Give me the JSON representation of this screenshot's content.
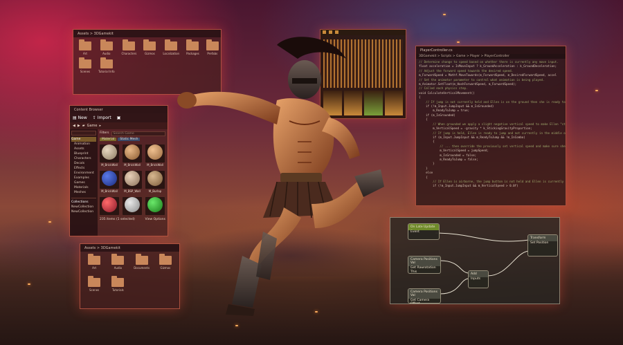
{
  "assets_top": {
    "breadcrumb": "Assets  >  3DGamekit",
    "folders": [
      "Art",
      "Audio",
      "Characters",
      "Gizmos",
      "Localization",
      "Packages",
      "Prefabs",
      "Scenes",
      "Tutorial Info"
    ]
  },
  "content_browser": {
    "title": "Content Browser",
    "new_label": "New",
    "import_label": "Import",
    "path_label": "Game",
    "filters_label": "Filters",
    "search_placeholder": "Search Game",
    "tree": [
      "Game",
      "Animation",
      "Assets",
      "Blueprint",
      "Characters",
      "Decals",
      "Effects",
      "Environment",
      "Examples",
      "Games",
      "Materials",
      "Meshes"
    ],
    "collections_label": "Collections",
    "collection_items": [
      "NewCollection",
      "NewCollection"
    ],
    "type_tabs": [
      "Material",
      "Static Mesh"
    ],
    "assets": [
      "M_BrickWall",
      "M_BrickWall",
      "M_BrickWall",
      "M_BrickWall",
      "M_BSP_Wall",
      "M_Burlap",
      "",
      "",
      ""
    ],
    "status": "235 items (1 selected)",
    "view_options": "View Options"
  },
  "assets_bottom": {
    "breadcrumb": "Assets  >  3DGamekit",
    "folders": [
      "Art",
      "Audio",
      "Documents",
      "Gizmos",
      "Scenes",
      "Tutorials"
    ]
  },
  "code_editor": {
    "tab": "PlayerController.cs",
    "path": "3DGamekit  >  Scripts  >  Game  >  Player  >  PlayerController",
    "lines": [
      "// Determine change to speed based on whether there is currently any move input.",
      "float acceleration = IsMoveInput ? k_GroundAcceleration : k_GroundDeceleration;",
      "",
      "// Adjust the forward speed towards the desired speed.",
      "m_ForwardSpeed = Mathf.MoveTowards(m_ForwardSpeed, m_DesiredForwardSpeed, accel",
      "",
      "// Set the animator parameter to control what animation is being played.",
      "m_Animator.SetFloat(m_HashForwardSpeed, m_ForwardSpeed);",
      "",
      "",
      "// Called each physics step.",
      "void CalculateVerticalMovement()",
      "{",
      "    // If jump is not currently held and Ellen is on the ground then she is ready to",
      "    if (!m_Input.JumpInput && m_IsGrounded)",
      "        m_ReadyToJump = true;",
      "",
      "    if (m_IsGrounded)",
      "    {",
      "        // When grounded we apply a slight negative vertical speed to make Ellen \"stick\"",
      "        m_VerticalSpeed = -gravity * k_StickingGravityProportion;",
      "",
      "        // If jump is held, Ellen is ready to jump and not currently in the middle of",
      "        if (m_Input.JumpInput && m_ReadyToJump && !m_InCombo)",
      "        {",
      "            // ... then override the previously set vertical speed and make sure she",
      "            m_VerticalSpeed = jumpSpeed;",
      "            m_IsGrounded = false;",
      "            m_ReadyToJump = false;",
      "        }",
      "    }",
      "    else",
      "    {",
      "        // If Ellen is airborne, the jump button is not held and Ellen is currently m",
      "        if (!m_Input.JumpInput && m_VerticalSpeed > 0.0f)"
    ]
  },
  "node_graph": {
    "nodes": [
      {
        "title": "On Late Update",
        "subtitle": "Event"
      },
      {
        "title": "Camera Positions Val",
        "subtitle": "Get Rawrotation"
      },
      {
        "title": "Add",
        "subtitle": "Inputs"
      },
      {
        "title": "Transform",
        "subtitle": "Set Position"
      },
      {
        "title": "Camera Positions Val",
        "subtitle": "Get Camera Offset"
      }
    ],
    "this_label": "This"
  },
  "colors": {
    "panel_border": "#ff785a",
    "folder": "#c9875a",
    "node_green": "#6f8a2a"
  }
}
